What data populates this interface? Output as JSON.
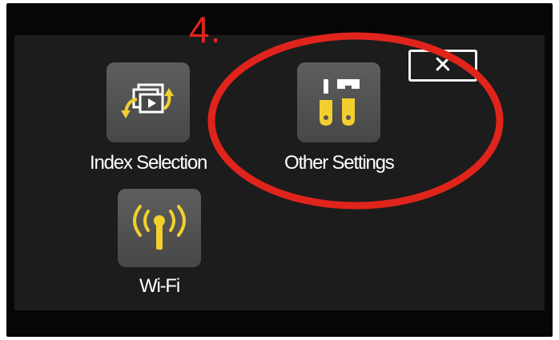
{
  "annotation": {
    "step_label": "4.",
    "highlight_color": "#e0241c"
  },
  "header": {
    "close_label": "✕",
    "close_icon": "close-icon"
  },
  "menu": {
    "items": [
      {
        "label": "Index Selection",
        "icon": "index-selection-icon"
      },
      {
        "label": "Other Settings",
        "icon": "tools-icon"
      },
      {
        "label": "Wi-Fi",
        "icon": "wifi-antenna-icon"
      }
    ]
  },
  "colors": {
    "icon_yellow": "#f2cf2e",
    "tile": "#555555",
    "screen": "#1c1c1c"
  }
}
